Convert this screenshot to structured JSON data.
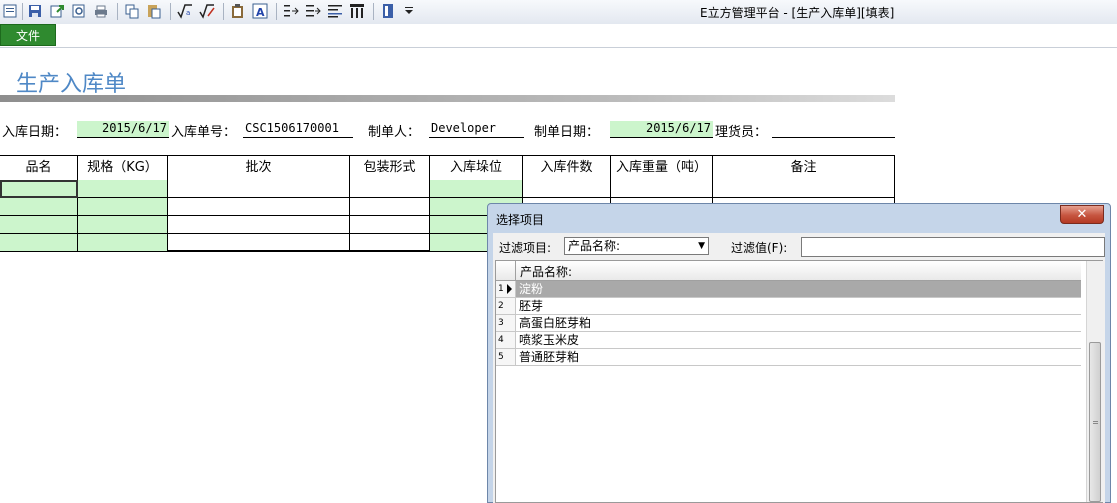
{
  "window": {
    "title": "E立方管理平台 - [生产入库单][填表]"
  },
  "toolbar": {
    "file_tab": "文件",
    "icons": [
      "document-icon",
      "save-icon",
      "export-icon",
      "preview-icon",
      "print-icon",
      "copy-icon",
      "paste-icon",
      "sqrt-icon",
      "formula-icon",
      "clipboard-icon",
      "text-icon",
      "indent-icon",
      "outdent-icon",
      "list-icon",
      "columns-icon",
      "bookmark-icon",
      "dropdown-icon"
    ]
  },
  "form": {
    "title": "生产入库单",
    "fields": {
      "in_date_label": "入库日期：",
      "in_date_value": "2015/6/17",
      "order_no_label": "入库单号：",
      "order_no_value": "CSC1506170001",
      "maker_label": "制单人：",
      "maker_value": "Developer",
      "make_date_label": "制单日期：",
      "make_date_value": "2015/6/17",
      "keeper_label": "理货员：",
      "keeper_value": ""
    },
    "table": {
      "headers": [
        "品名",
        "规格（KG）",
        "批次",
        "包装形式",
        "入库垛位",
        "入库件数",
        "入库重量（吨）",
        "备注"
      ],
      "row_count": 4
    }
  },
  "dialog": {
    "title": "选择项目",
    "close_label": "✕",
    "filter_item_label": "过滤项目:",
    "filter_item_value": "产品名称:",
    "filter_value_label": "过滤值(F):",
    "filter_value": "",
    "list_header": "产品名称:",
    "items": [
      {
        "num": "1",
        "name": "淀粉",
        "selected": true
      },
      {
        "num": "2",
        "name": "胚芽",
        "selected": false
      },
      {
        "num": "3",
        "name": "高蛋白胚芽粕",
        "selected": false
      },
      {
        "num": "4",
        "name": "喷浆玉米皮",
        "selected": false
      },
      {
        "num": "5",
        "name": "普通胚芽粕",
        "selected": false
      }
    ]
  },
  "colors": {
    "green_cell": "#ccf5cc",
    "title_blue": "#4f88c6",
    "file_tab": "#2f8a2f",
    "dialog_frame": "#c5d5e9"
  }
}
